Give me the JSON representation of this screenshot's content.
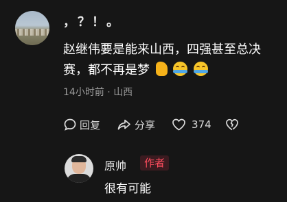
{
  "comment": {
    "user_name": "，？！。",
    "text": "赵继伟要是能来山西，四强甚至总决赛，都不再是梦",
    "time": "14小时前",
    "location": "山西",
    "separator": "·"
  },
  "actions": {
    "reply_label": "回复",
    "share_label": "分享",
    "like_count": "374"
  },
  "reply": {
    "user_name": "原帅",
    "badge": "作者",
    "text": "很有可能"
  },
  "colors": {
    "background": "#161616",
    "badge_text": "#ff4d5e",
    "badge_bg": "#3b1b20",
    "meta_text": "#9a9a9a"
  },
  "icons": [
    "comment-bubble-icon",
    "share-arrow-icon",
    "heart-icon",
    "broken-heart-icon",
    "thumbs-up-emoji",
    "crying-laughing-emoji"
  ]
}
